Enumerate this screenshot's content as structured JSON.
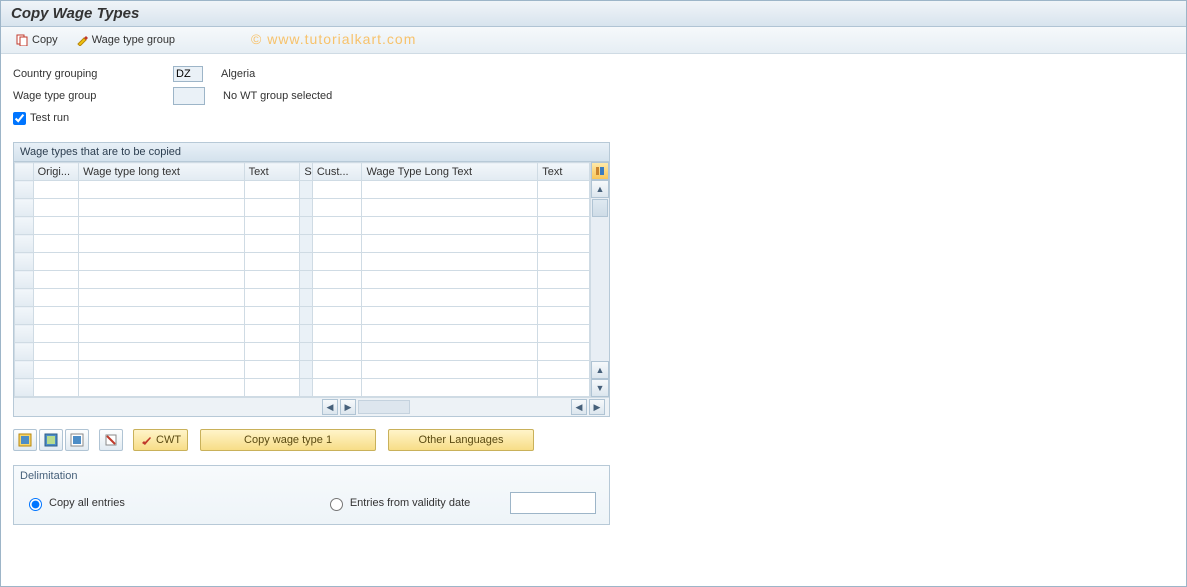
{
  "title": "Copy Wage Types",
  "watermark": "©  www.tutorialkart.com",
  "toolbar": {
    "copy_label": "Copy",
    "wtg_label": "Wage type group"
  },
  "fields": {
    "country_grouping_label": "Country grouping",
    "country_grouping_value": "DZ",
    "country_grouping_text": "Algeria",
    "wage_type_group_label": "Wage type group",
    "wage_type_group_text": "No WT group selected",
    "test_run_label": "Test run",
    "test_run_checked": true
  },
  "grid": {
    "title": "Wage types that are to be copied",
    "columns": [
      "Origi...",
      "Wage type long text",
      "Text",
      "S",
      "Cust...",
      "Wage Type Long Text",
      "Text"
    ],
    "row_count": 12
  },
  "buttons": {
    "cwt": "CWT",
    "copy1": "Copy wage type 1",
    "other_lang": "Other Languages"
  },
  "delimitation": {
    "title": "Delimitation",
    "opt_all": "Copy all entries",
    "opt_from": "Entries from validity date",
    "selected": "all",
    "date_value": ""
  }
}
